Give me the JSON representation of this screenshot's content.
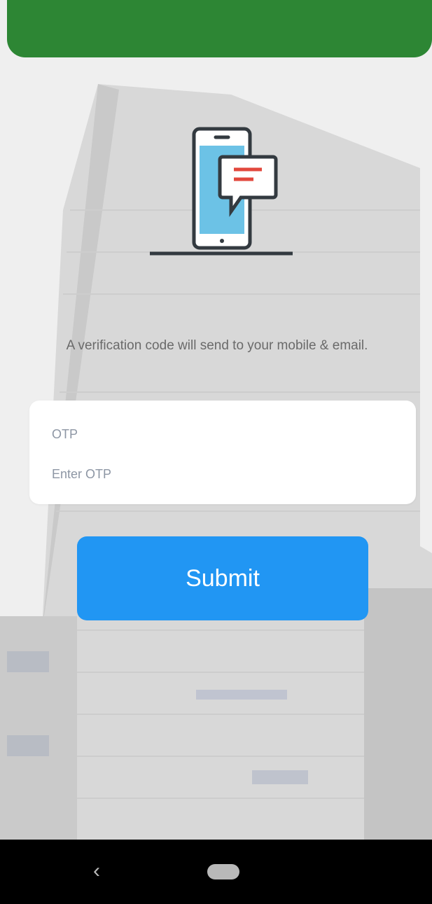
{
  "header": {
    "color": "#2d8634"
  },
  "illustration": {
    "icon": "phone-message-icon"
  },
  "message": {
    "text": "A verification code will send to your mobile & email."
  },
  "otp_field": {
    "label": "OTP",
    "placeholder": "Enter OTP",
    "value": ""
  },
  "submit_button": {
    "label": "Submit",
    "color": "#2196f3"
  },
  "nav_bar": {
    "back_glyph": "‹"
  }
}
